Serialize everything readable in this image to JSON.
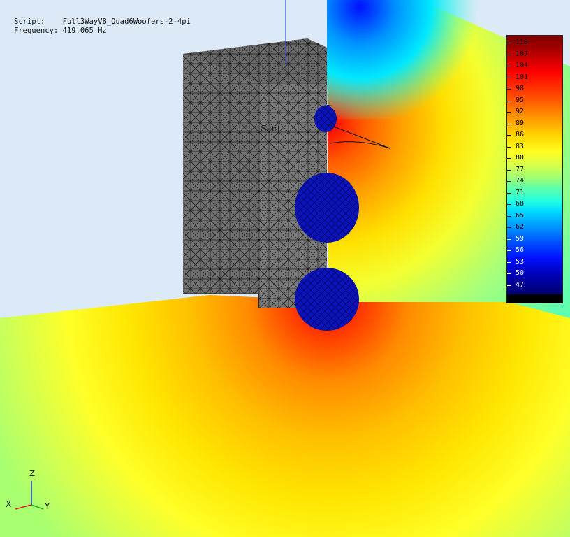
{
  "info": {
    "script_label": "Script:",
    "script_value": "Full3WayV8_Quad6Woofers-2-4pi",
    "frequency_label": "Frequency:",
    "frequency_value": "419.065 Hz"
  },
  "scene": {
    "start_label": "Start"
  },
  "colorbar": {
    "ticks": [
      "110",
      "107",
      "104",
      "101",
      "98",
      "95",
      "92",
      "89",
      "86",
      "83",
      "80",
      "77",
      "74",
      "71",
      "68",
      "65",
      "62",
      "59",
      "56",
      "53",
      "50",
      "47"
    ]
  },
  "axes": {
    "x_label": "X",
    "y_label": "Y",
    "z_label": "Z"
  },
  "colors": {
    "background": "#dce9f7",
    "cabinet": "#6a6a6a",
    "driver": "#0a14b8"
  }
}
